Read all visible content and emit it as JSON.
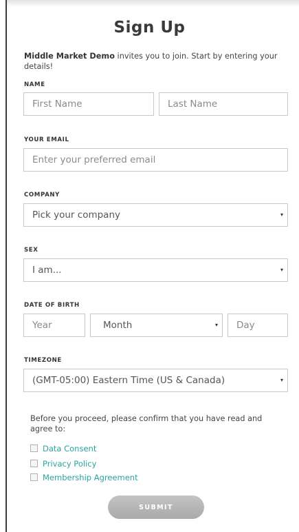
{
  "title": "Sign Up",
  "invite": {
    "org": "Middle Market Demo",
    "text": " invites you to join. Start by entering your details!"
  },
  "labels": {
    "name": "NAME",
    "email": "YOUR EMAIL",
    "company": "COMPANY",
    "sex": "SEX",
    "dob": "DATE OF BIRTH",
    "timezone": "TIMEZONE"
  },
  "fields": {
    "first_name_placeholder": "First Name",
    "last_name_placeholder": "Last Name",
    "email_placeholder": "Enter your preferred email",
    "company_selected": "Pick your company",
    "sex_selected": "I am...",
    "year_placeholder": "Year",
    "month_selected": "Month",
    "day_placeholder": "Day",
    "timezone_selected": "(GMT-05:00) Eastern Time (US & Canada)"
  },
  "consent": {
    "text": "Before you proceed, please confirm that you have read and agree to:",
    "items": [
      "Data Consent",
      "Privacy Policy",
      "Membership Agreement"
    ]
  },
  "submit_label": "SUBMIT",
  "icons": {
    "dropdown": "▾"
  },
  "colors": {
    "link": "#2aa3a3",
    "button": "#b3b3b3",
    "border": "#c8c8c8"
  }
}
